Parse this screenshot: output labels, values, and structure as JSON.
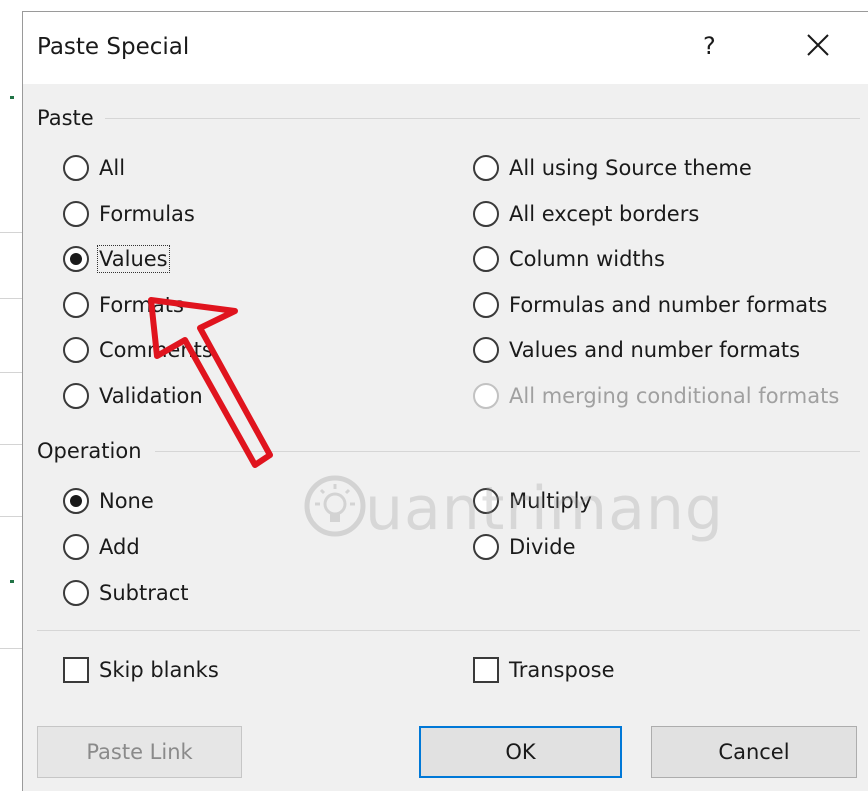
{
  "dialog": {
    "title": "Paste Special",
    "help_glyph": "?",
    "close_icon": "close-icon"
  },
  "paste": {
    "label": "Paste",
    "options_left": [
      {
        "label": "All",
        "checked": false,
        "disabled": false
      },
      {
        "label": "Formulas",
        "checked": false,
        "disabled": false
      },
      {
        "label": "Values",
        "checked": true,
        "disabled": false
      },
      {
        "label": "Formats",
        "checked": false,
        "disabled": false
      },
      {
        "label": "Comments",
        "checked": false,
        "disabled": false
      },
      {
        "label": "Validation",
        "checked": false,
        "disabled": false
      }
    ],
    "options_right": [
      {
        "label": "All using Source theme",
        "checked": false,
        "disabled": false
      },
      {
        "label": "All except borders",
        "checked": false,
        "disabled": false
      },
      {
        "label": "Column widths",
        "checked": false,
        "disabled": false
      },
      {
        "label": "Formulas and number formats",
        "checked": false,
        "disabled": false
      },
      {
        "label": "Values and number formats",
        "checked": false,
        "disabled": false
      },
      {
        "label": "All merging conditional formats",
        "checked": false,
        "disabled": true
      }
    ]
  },
  "operation": {
    "label": "Operation",
    "options_left": [
      {
        "label": "None",
        "checked": true
      },
      {
        "label": "Add",
        "checked": false
      },
      {
        "label": "Subtract",
        "checked": false
      }
    ],
    "options_right": [
      {
        "label": "Multiply",
        "checked": false
      },
      {
        "label": "Divide",
        "checked": false
      }
    ]
  },
  "checkboxes": {
    "skip_blanks": {
      "label": "Skip blanks",
      "checked": false
    },
    "transpose": {
      "label": "Transpose",
      "checked": false
    }
  },
  "buttons": {
    "paste_link": "Paste Link",
    "ok": "OK",
    "cancel": "Cancel"
  },
  "watermark": {
    "text": "uantrimang"
  },
  "colors": {
    "dialog_bg": "#f0f0f0",
    "default_button_border": "#0078d7",
    "annotation_arrow": "#e0141e"
  }
}
